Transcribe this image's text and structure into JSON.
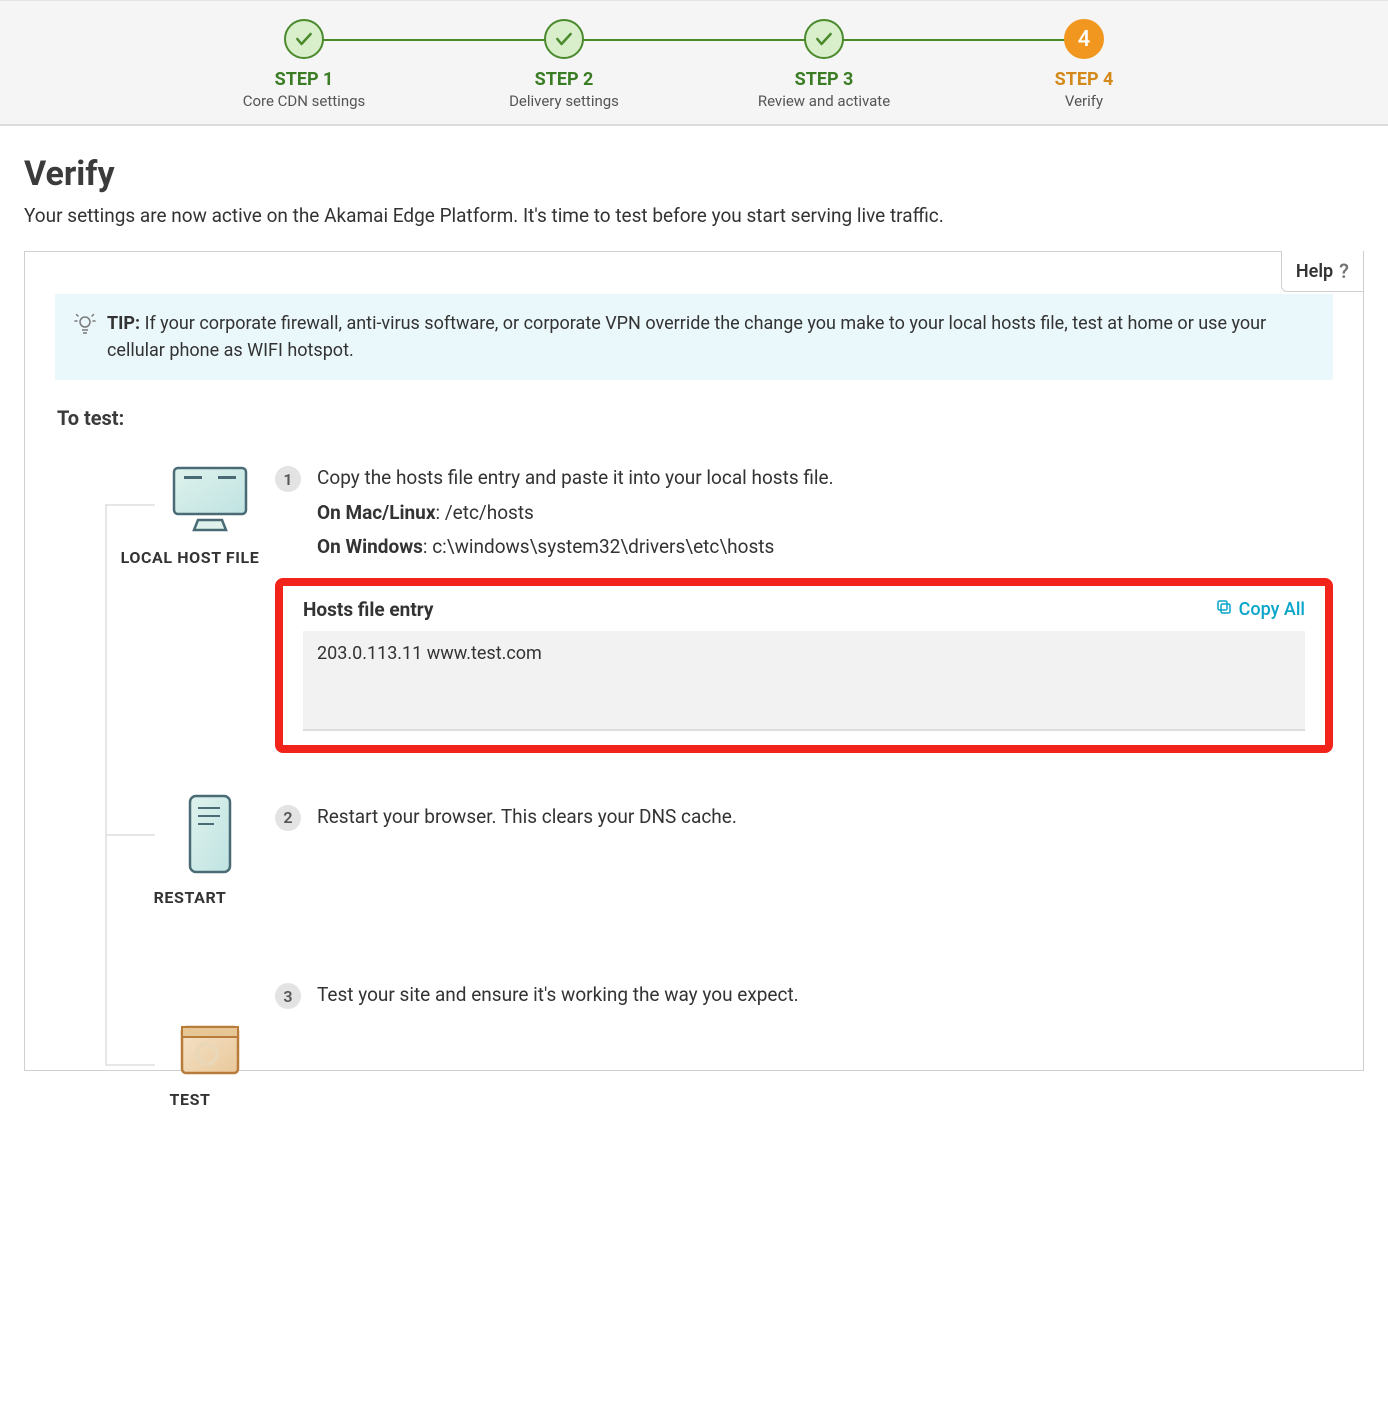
{
  "stepper": [
    {
      "title": "STEP 1",
      "sub": "Core CDN settings",
      "status": "done"
    },
    {
      "title": "STEP 2",
      "sub": "Delivery settings",
      "status": "done"
    },
    {
      "title": "STEP 3",
      "sub": "Review and activate",
      "status": "done"
    },
    {
      "title": "STEP 4",
      "sub": "Verify",
      "status": "active",
      "num": "4"
    }
  ],
  "page": {
    "title": "Verify",
    "subtitle": "Your settings are now active on the Akamai Edge Platform. It's time to test before you start serving live traffic."
  },
  "help": {
    "label": "Help",
    "glyph": "?"
  },
  "tip": {
    "label": "TIP:",
    "text": "If your corporate firewall, anti-virus software, or corporate VPN override the change you make to your local hosts file, test at home or use your cellular phone as WIFI hotspot."
  },
  "to_test_label": "To test:",
  "rail": {
    "item1": "LOCAL HOST FILE",
    "item2": "RESTART",
    "item3": "TEST"
  },
  "steps": {
    "s1": {
      "num": "1",
      "text": "Copy the hosts file entry and paste it into your local hosts file.",
      "mac_label": "On Mac/Linux",
      "mac_path": ": /etc/hosts",
      "win_label": "On Windows",
      "win_path": ": c:\\windows\\system32\\drivers\\etc\\hosts"
    },
    "hosts": {
      "title": "Hosts file entry",
      "copy": "Copy All",
      "entry": "203.0.113.11 www.test.com"
    },
    "s2": {
      "num": "2",
      "text": "Restart your browser. This clears your DNS cache."
    },
    "s3": {
      "num": "3",
      "text": "Test your site and ensure it's working the way you expect."
    }
  }
}
